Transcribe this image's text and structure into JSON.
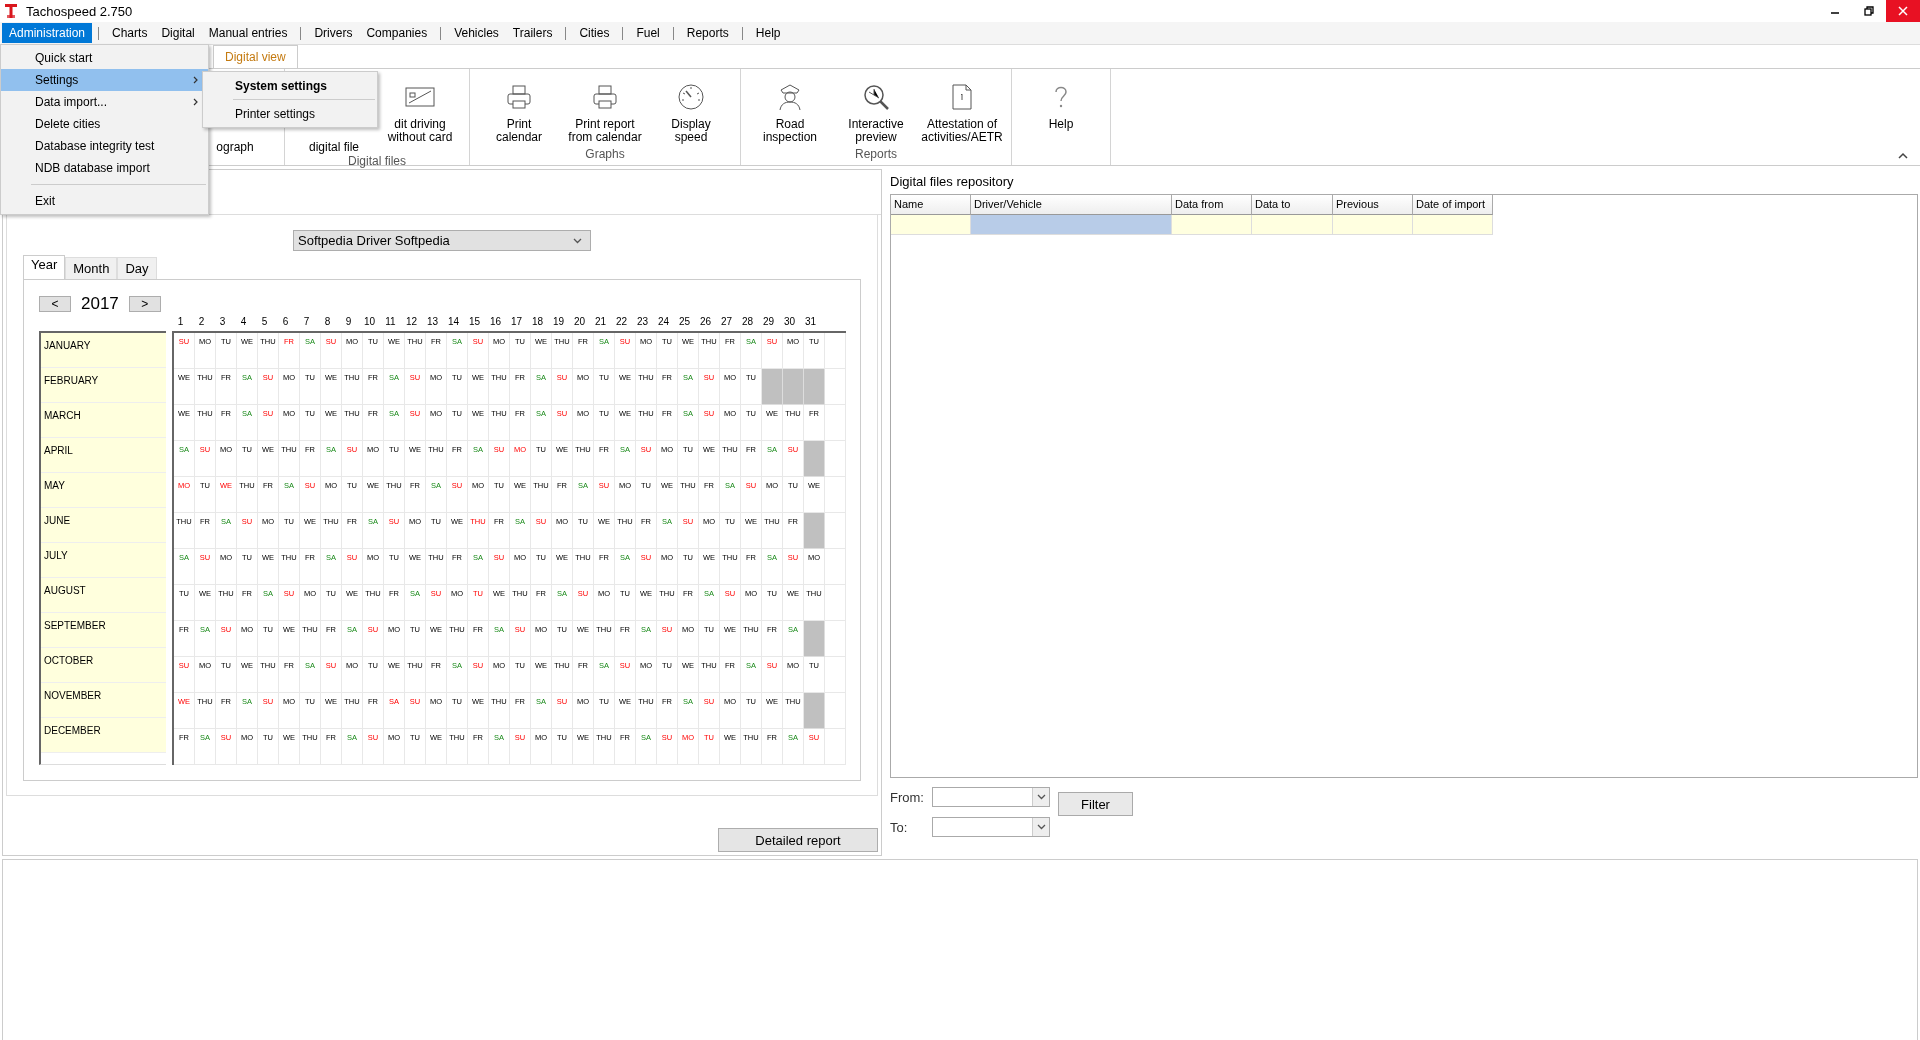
{
  "window": {
    "title": "Tachospeed 2.750"
  },
  "menu_bar": [
    {
      "label": "Administration",
      "selected": true,
      "separator_before": false
    },
    {
      "label": "Charts",
      "selected": false,
      "separator_before": true
    },
    {
      "label": "Digital",
      "selected": false,
      "separator_before": false
    },
    {
      "label": "Manual entries",
      "selected": false,
      "separator_before": false
    },
    {
      "label": "Drivers",
      "selected": false,
      "separator_before": true
    },
    {
      "label": "Companies",
      "selected": false,
      "separator_before": false
    },
    {
      "label": "Vehicles",
      "selected": false,
      "separator_before": true
    },
    {
      "label": "Trailers",
      "selected": false,
      "separator_before": false
    },
    {
      "label": "Cities",
      "selected": false,
      "separator_before": true
    },
    {
      "label": "Fuel",
      "selected": false,
      "separator_before": true
    },
    {
      "label": "Reports",
      "selected": false,
      "separator_before": true
    },
    {
      "label": "Help",
      "selected": false,
      "separator_before": true
    }
  ],
  "admin_menu": [
    {
      "kind": "item",
      "label": "Quick start",
      "selected": false,
      "submenu": false
    },
    {
      "kind": "item",
      "label": "Settings",
      "selected": true,
      "submenu": true
    },
    {
      "kind": "item",
      "label": "Data import...",
      "selected": false,
      "submenu": true
    },
    {
      "kind": "item",
      "label": "Delete cities",
      "selected": false,
      "submenu": false
    },
    {
      "kind": "item",
      "label": "Database integrity test",
      "selected": false,
      "submenu": false
    },
    {
      "kind": "item",
      "label": "NDB database import",
      "selected": false,
      "submenu": false
    },
    {
      "kind": "separator"
    },
    {
      "kind": "item",
      "label": "Exit",
      "selected": false,
      "submenu": false
    }
  ],
  "settings_submenu": [
    {
      "kind": "item",
      "label": "System settings",
      "bold": true
    },
    {
      "kind": "separator"
    },
    {
      "kind": "item",
      "label": "Printer settings",
      "bold": false
    }
  ],
  "ribbon": {
    "tabs": [
      {
        "label": "Digital view",
        "selected": true
      }
    ],
    "groups": [
      {
        "items": [
          {
            "kind": "covered",
            "lines": [
              "ograph"
            ]
          }
        ]
      },
      {
        "label": "Digital files",
        "items": [
          {
            "kind": "covered",
            "lines": [
              "digital file"
            ]
          },
          {
            "kind": "button",
            "lines": [
              "dit driving",
              "without card"
            ]
          }
        ]
      },
      {
        "label": "Graphs",
        "items": [
          {
            "kind": "button",
            "lines": [
              "Print",
              "calendar"
            ]
          },
          {
            "kind": "button",
            "lines": [
              "Print report",
              "from calendar"
            ]
          },
          {
            "kind": "button",
            "lines": [
              "Display",
              "speed"
            ]
          }
        ]
      },
      {
        "label": "Reports",
        "items": [
          {
            "kind": "button",
            "lines": [
              "Road",
              "inspection"
            ]
          },
          {
            "kind": "button",
            "lines": [
              "Interactive",
              "preview"
            ]
          },
          {
            "kind": "button",
            "lines": [
              "Attestation of",
              "activities/AETR"
            ]
          }
        ]
      },
      {
        "items": [
          {
            "kind": "button",
            "lines": [
              "Help"
            ]
          }
        ]
      }
    ]
  },
  "driver_select": {
    "value": "Softpedia Driver Softpedia"
  },
  "view_tabs": [
    {
      "label": "Year",
      "selected": true
    },
    {
      "label": "Month",
      "selected": false
    },
    {
      "label": "Day",
      "selected": false
    }
  ],
  "year_nav": {
    "prev": "<",
    "year": "2017",
    "next": ">"
  },
  "calendar": {
    "day_numbers": [
      "1",
      "2",
      "3",
      "4",
      "5",
      "6",
      "7",
      "8",
      "9",
      "10",
      "11",
      "12",
      "13",
      "14",
      "15",
      "16",
      "17",
      "18",
      "19",
      "20",
      "21",
      "22",
      "23",
      "24",
      "25",
      "26",
      "27",
      "28",
      "29",
      "30",
      "31"
    ],
    "months": [
      {
        "name": "JANUARY",
        "days": [
          {
            "day": "SU",
            "kind": "off"
          },
          {
            "day": "MO",
            "kind": "work"
          },
          {
            "day": "TU",
            "kind": "work"
          },
          {
            "day": "WE",
            "kind": "work"
          },
          {
            "day": "THU",
            "kind": "work"
          },
          {
            "day": "FR",
            "kind": "off"
          },
          {
            "day": "SA",
            "kind": "sat"
          },
          {
            "day": "SU",
            "kind": "off"
          },
          {
            "day": "MO",
            "kind": "work"
          },
          {
            "day": "TU",
            "kind": "work"
          },
          {
            "day": "WE",
            "kind": "work"
          },
          {
            "day": "THU",
            "kind": "work"
          },
          {
            "day": "FR",
            "kind": "work"
          },
          {
            "day": "SA",
            "kind": "sat"
          },
          {
            "day": "SU",
            "kind": "off"
          },
          {
            "day": "MO",
            "kind": "work"
          },
          {
            "day": "TU",
            "kind": "work"
          },
          {
            "day": "WE",
            "kind": "work"
          },
          {
            "day": "THU",
            "kind": "work"
          },
          {
            "day": "FR",
            "kind": "work"
          },
          {
            "day": "SA",
            "kind": "sat"
          },
          {
            "day": "SU",
            "kind": "off"
          },
          {
            "day": "MO",
            "kind": "work"
          },
          {
            "day": "TU",
            "kind": "work"
          },
          {
            "day": "WE",
            "kind": "work"
          },
          {
            "day": "THU",
            "kind": "work"
          },
          {
            "day": "FR",
            "kind": "work"
          },
          {
            "day": "SA",
            "kind": "sat"
          },
          {
            "day": "SU",
            "kind": "off"
          },
          {
            "day": "MO",
            "kind": "work"
          },
          {
            "day": "TU",
            "kind": "work"
          }
        ]
      },
      {
        "name": "FEBRUARY",
        "days": [
          {
            "day": "WE",
            "kind": "work"
          },
          {
            "day": "THU",
            "kind": "work"
          },
          {
            "day": "FR",
            "kind": "work"
          },
          {
            "day": "SA",
            "kind": "sat"
          },
          {
            "day": "SU",
            "kind": "off"
          },
          {
            "day": "MO",
            "kind": "work"
          },
          {
            "day": "TU",
            "kind": "work"
          },
          {
            "day": "WE",
            "kind": "work"
          },
          {
            "day": "THU",
            "kind": "work"
          },
          {
            "day": "FR",
            "kind": "work"
          },
          {
            "day": "SA",
            "kind": "sat"
          },
          {
            "day": "SU",
            "kind": "off"
          },
          {
            "day": "MO",
            "kind": "work"
          },
          {
            "day": "TU",
            "kind": "work"
          },
          {
            "day": "WE",
            "kind": "work"
          },
          {
            "day": "THU",
            "kind": "work"
          },
          {
            "day": "FR",
            "kind": "work"
          },
          {
            "day": "SA",
            "kind": "sat"
          },
          {
            "day": "SU",
            "kind": "off"
          },
          {
            "day": "MO",
            "kind": "work"
          },
          {
            "day": "TU",
            "kind": "work"
          },
          {
            "day": "WE",
            "kind": "work"
          },
          {
            "day": "THU",
            "kind": "work"
          },
          {
            "day": "FR",
            "kind": "work"
          },
          {
            "day": "SA",
            "kind": "sat"
          },
          {
            "day": "SU",
            "kind": "off"
          },
          {
            "day": "MO",
            "kind": "work"
          },
          {
            "day": "TU",
            "kind": "work"
          },
          {
            "kind": "none"
          },
          {
            "kind": "none"
          },
          {
            "kind": "none"
          }
        ]
      },
      {
        "name": "MARCH",
        "days": [
          {
            "day": "WE",
            "kind": "work"
          },
          {
            "day": "THU",
            "kind": "work"
          },
          {
            "day": "FR",
            "kind": "work"
          },
          {
            "day": "SA",
            "kind": "sat"
          },
          {
            "day": "SU",
            "kind": "off"
          },
          {
            "day": "MO",
            "kind": "work"
          },
          {
            "day": "TU",
            "kind": "work"
          },
          {
            "day": "WE",
            "kind": "work"
          },
          {
            "day": "THU",
            "kind": "work"
          },
          {
            "day": "FR",
            "kind": "work"
          },
          {
            "day": "SA",
            "kind": "sat"
          },
          {
            "day": "SU",
            "kind": "off"
          },
          {
            "day": "MO",
            "kind": "work"
          },
          {
            "day": "TU",
            "kind": "work"
          },
          {
            "day": "WE",
            "kind": "work"
          },
          {
            "day": "THU",
            "kind": "work"
          },
          {
            "day": "FR",
            "kind": "work"
          },
          {
            "day": "SA",
            "kind": "sat"
          },
          {
            "day": "SU",
            "kind": "off"
          },
          {
            "day": "MO",
            "kind": "work"
          },
          {
            "day": "TU",
            "kind": "work"
          },
          {
            "day": "WE",
            "kind": "work"
          },
          {
            "day": "THU",
            "kind": "work"
          },
          {
            "day": "FR",
            "kind": "work"
          },
          {
            "day": "SA",
            "kind": "sat"
          },
          {
            "day": "SU",
            "kind": "off"
          },
          {
            "day": "MO",
            "kind": "work"
          },
          {
            "day": "TU",
            "kind": "work"
          },
          {
            "day": "WE",
            "kind": "work"
          },
          {
            "day": "THU",
            "kind": "work"
          },
          {
            "day": "FR",
            "kind": "work"
          }
        ]
      },
      {
        "name": "APRIL",
        "days": [
          {
            "day": "SA",
            "kind": "sat"
          },
          {
            "day": "SU",
            "kind": "off"
          },
          {
            "day": "MO",
            "kind": "work"
          },
          {
            "day": "TU",
            "kind": "work"
          },
          {
            "day": "WE",
            "kind": "work"
          },
          {
            "day": "THU",
            "kind": "work"
          },
          {
            "day": "FR",
            "kind": "work"
          },
          {
            "day": "SA",
            "kind": "sat"
          },
          {
            "day": "SU",
            "kind": "off"
          },
          {
            "day": "MO",
            "kind": "work"
          },
          {
            "day": "TU",
            "kind": "work"
          },
          {
            "day": "WE",
            "kind": "work"
          },
          {
            "day": "THU",
            "kind": "work"
          },
          {
            "day": "FR",
            "kind": "work"
          },
          {
            "day": "SA",
            "kind": "sat"
          },
          {
            "day": "SU",
            "kind": "off"
          },
          {
            "day": "MO",
            "kind": "off"
          },
          {
            "day": "TU",
            "kind": "work"
          },
          {
            "day": "WE",
            "kind": "work"
          },
          {
            "day": "THU",
            "kind": "work"
          },
          {
            "day": "FR",
            "kind": "work"
          },
          {
            "day": "SA",
            "kind": "sat"
          },
          {
            "day": "SU",
            "kind": "off"
          },
          {
            "day": "MO",
            "kind": "work"
          },
          {
            "day": "TU",
            "kind": "work"
          },
          {
            "day": "WE",
            "kind": "work"
          },
          {
            "day": "THU",
            "kind": "work"
          },
          {
            "day": "FR",
            "kind": "work"
          },
          {
            "day": "SA",
            "kind": "sat"
          },
          {
            "day": "SU",
            "kind": "off"
          },
          {
            "kind": "none"
          }
        ]
      },
      {
        "name": "MAY",
        "days": [
          {
            "day": "MO",
            "kind": "off"
          },
          {
            "day": "TU",
            "kind": "work"
          },
          {
            "day": "WE",
            "kind": "off"
          },
          {
            "day": "THU",
            "kind": "work"
          },
          {
            "day": "FR",
            "kind": "work"
          },
          {
            "day": "SA",
            "kind": "sat"
          },
          {
            "day": "SU",
            "kind": "off"
          },
          {
            "day": "MO",
            "kind": "work"
          },
          {
            "day": "TU",
            "kind": "work"
          },
          {
            "day": "WE",
            "kind": "work"
          },
          {
            "day": "THU",
            "kind": "work"
          },
          {
            "day": "FR",
            "kind": "work"
          },
          {
            "day": "SA",
            "kind": "sat"
          },
          {
            "day": "SU",
            "kind": "off"
          },
          {
            "day": "MO",
            "kind": "work"
          },
          {
            "day": "TU",
            "kind": "work"
          },
          {
            "day": "WE",
            "kind": "work"
          },
          {
            "day": "THU",
            "kind": "work"
          },
          {
            "day": "FR",
            "kind": "work"
          },
          {
            "day": "SA",
            "kind": "sat"
          },
          {
            "day": "SU",
            "kind": "off"
          },
          {
            "day": "MO",
            "kind": "work"
          },
          {
            "day": "TU",
            "kind": "work"
          },
          {
            "day": "WE",
            "kind": "work"
          },
          {
            "day": "THU",
            "kind": "work"
          },
          {
            "day": "FR",
            "kind": "work"
          },
          {
            "day": "SA",
            "kind": "sat"
          },
          {
            "day": "SU",
            "kind": "off"
          },
          {
            "day": "MO",
            "kind": "work"
          },
          {
            "day": "TU",
            "kind": "work"
          },
          {
            "day": "WE",
            "kind": "work"
          }
        ]
      },
      {
        "name": "JUNE",
        "days": [
          {
            "day": "THU",
            "kind": "work"
          },
          {
            "day": "FR",
            "kind": "work"
          },
          {
            "day": "SA",
            "kind": "sat"
          },
          {
            "day": "SU",
            "kind": "off"
          },
          {
            "day": "MO",
            "kind": "work"
          },
          {
            "day": "TU",
            "kind": "work"
          },
          {
            "day": "WE",
            "kind": "work"
          },
          {
            "day": "THU",
            "kind": "work"
          },
          {
            "day": "FR",
            "kind": "work"
          },
          {
            "day": "SA",
            "kind": "sat"
          },
          {
            "day": "SU",
            "kind": "off"
          },
          {
            "day": "MO",
            "kind": "work"
          },
          {
            "day": "TU",
            "kind": "work"
          },
          {
            "day": "WE",
            "kind": "work"
          },
          {
            "day": "THU",
            "kind": "off"
          },
          {
            "day": "FR",
            "kind": "work"
          },
          {
            "day": "SA",
            "kind": "sat"
          },
          {
            "day": "SU",
            "kind": "off"
          },
          {
            "day": "MO",
            "kind": "work"
          },
          {
            "day": "TU",
            "kind": "work"
          },
          {
            "day": "WE",
            "kind": "work"
          },
          {
            "day": "THU",
            "kind": "work"
          },
          {
            "day": "FR",
            "kind": "work"
          },
          {
            "day": "SA",
            "kind": "sat"
          },
          {
            "day": "SU",
            "kind": "off"
          },
          {
            "day": "MO",
            "kind": "work"
          },
          {
            "day": "TU",
            "kind": "work"
          },
          {
            "day": "WE",
            "kind": "work"
          },
          {
            "day": "THU",
            "kind": "work"
          },
          {
            "day": "FR",
            "kind": "work"
          },
          {
            "kind": "none"
          }
        ]
      },
      {
        "name": "JULY",
        "days": [
          {
            "day": "SA",
            "kind": "sat"
          },
          {
            "day": "SU",
            "kind": "off"
          },
          {
            "day": "MO",
            "kind": "work"
          },
          {
            "day": "TU",
            "kind": "work"
          },
          {
            "day": "WE",
            "kind": "work"
          },
          {
            "day": "THU",
            "kind": "work"
          },
          {
            "day": "FR",
            "kind": "work"
          },
          {
            "day": "SA",
            "kind": "sat"
          },
          {
            "day": "SU",
            "kind": "off"
          },
          {
            "day": "MO",
            "kind": "work"
          },
          {
            "day": "TU",
            "kind": "work"
          },
          {
            "day": "WE",
            "kind": "work"
          },
          {
            "day": "THU",
            "kind": "work"
          },
          {
            "day": "FR",
            "kind": "work"
          },
          {
            "day": "SA",
            "kind": "sat"
          },
          {
            "day": "SU",
            "kind": "off"
          },
          {
            "day": "MO",
            "kind": "work"
          },
          {
            "day": "TU",
            "kind": "work"
          },
          {
            "day": "WE",
            "kind": "work"
          },
          {
            "day": "THU",
            "kind": "work"
          },
          {
            "day": "FR",
            "kind": "work"
          },
          {
            "day": "SA",
            "kind": "sat"
          },
          {
            "day": "SU",
            "kind": "off"
          },
          {
            "day": "MO",
            "kind": "work"
          },
          {
            "day": "TU",
            "kind": "work"
          },
          {
            "day": "WE",
            "kind": "work"
          },
          {
            "day": "THU",
            "kind": "work"
          },
          {
            "day": "FR",
            "kind": "work"
          },
          {
            "day": "SA",
            "kind": "sat"
          },
          {
            "day": "SU",
            "kind": "off"
          },
          {
            "day": "MO",
            "kind": "work"
          }
        ]
      },
      {
        "name": "AUGUST",
        "days": [
          {
            "day": "TU",
            "kind": "work"
          },
          {
            "day": "WE",
            "kind": "work"
          },
          {
            "day": "THU",
            "kind": "work"
          },
          {
            "day": "FR",
            "kind": "work"
          },
          {
            "day": "SA",
            "kind": "sat"
          },
          {
            "day": "SU",
            "kind": "off"
          },
          {
            "day": "MO",
            "kind": "work"
          },
          {
            "day": "TU",
            "kind": "work"
          },
          {
            "day": "WE",
            "kind": "work"
          },
          {
            "day": "THU",
            "kind": "work"
          },
          {
            "day": "FR",
            "kind": "work"
          },
          {
            "day": "SA",
            "kind": "sat"
          },
          {
            "day": "SU",
            "kind": "off"
          },
          {
            "day": "MO",
            "kind": "work"
          },
          {
            "day": "TU",
            "kind": "off"
          },
          {
            "day": "WE",
            "kind": "work"
          },
          {
            "day": "THU",
            "kind": "work"
          },
          {
            "day": "FR",
            "kind": "work"
          },
          {
            "day": "SA",
            "kind": "sat"
          },
          {
            "day": "SU",
            "kind": "off"
          },
          {
            "day": "MO",
            "kind": "work"
          },
          {
            "day": "TU",
            "kind": "work"
          },
          {
            "day": "WE",
            "kind": "work"
          },
          {
            "day": "THU",
            "kind": "work"
          },
          {
            "day": "FR",
            "kind": "work"
          },
          {
            "day": "SA",
            "kind": "sat"
          },
          {
            "day": "SU",
            "kind": "off"
          },
          {
            "day": "MO",
            "kind": "work"
          },
          {
            "day": "TU",
            "kind": "work"
          },
          {
            "day": "WE",
            "kind": "work"
          },
          {
            "day": "THU",
            "kind": "work"
          }
        ]
      },
      {
        "name": "SEPTEMBER",
        "days": [
          {
            "day": "FR",
            "kind": "work"
          },
          {
            "day": "SA",
            "kind": "sat"
          },
          {
            "day": "SU",
            "kind": "off"
          },
          {
            "day": "MO",
            "kind": "work"
          },
          {
            "day": "TU",
            "kind": "work"
          },
          {
            "day": "WE",
            "kind": "work"
          },
          {
            "day": "THU",
            "kind": "work"
          },
          {
            "day": "FR",
            "kind": "work"
          },
          {
            "day": "SA",
            "kind": "sat"
          },
          {
            "day": "SU",
            "kind": "off"
          },
          {
            "day": "MO",
            "kind": "work"
          },
          {
            "day": "TU",
            "kind": "work"
          },
          {
            "day": "WE",
            "kind": "work"
          },
          {
            "day": "THU",
            "kind": "work"
          },
          {
            "day": "FR",
            "kind": "work"
          },
          {
            "day": "SA",
            "kind": "sat"
          },
          {
            "day": "SU",
            "kind": "off"
          },
          {
            "day": "MO",
            "kind": "work"
          },
          {
            "day": "TU",
            "kind": "work"
          },
          {
            "day": "WE",
            "kind": "work"
          },
          {
            "day": "THU",
            "kind": "work"
          },
          {
            "day": "FR",
            "kind": "work"
          },
          {
            "day": "SA",
            "kind": "sat"
          },
          {
            "day": "SU",
            "kind": "off"
          },
          {
            "day": "MO",
            "kind": "work"
          },
          {
            "day": "TU",
            "kind": "work"
          },
          {
            "day": "WE",
            "kind": "work"
          },
          {
            "day": "THU",
            "kind": "work"
          },
          {
            "day": "FR",
            "kind": "work"
          },
          {
            "day": "SA",
            "kind": "sat"
          },
          {
            "kind": "none"
          }
        ]
      },
      {
        "name": "OCTOBER",
        "days": [
          {
            "day": "SU",
            "kind": "off"
          },
          {
            "day": "MO",
            "kind": "work"
          },
          {
            "day": "TU",
            "kind": "work"
          },
          {
            "day": "WE",
            "kind": "work"
          },
          {
            "day": "THU",
            "kind": "work"
          },
          {
            "day": "FR",
            "kind": "work"
          },
          {
            "day": "SA",
            "kind": "sat"
          },
          {
            "day": "SU",
            "kind": "off"
          },
          {
            "day": "MO",
            "kind": "work"
          },
          {
            "day": "TU",
            "kind": "work"
          },
          {
            "day": "WE",
            "kind": "work"
          },
          {
            "day": "THU",
            "kind": "work"
          },
          {
            "day": "FR",
            "kind": "work"
          },
          {
            "day": "SA",
            "kind": "sat"
          },
          {
            "day": "SU",
            "kind": "off"
          },
          {
            "day": "MO",
            "kind": "work"
          },
          {
            "day": "TU",
            "kind": "work"
          },
          {
            "day": "WE",
            "kind": "work"
          },
          {
            "day": "THU",
            "kind": "work"
          },
          {
            "day": "FR",
            "kind": "work"
          },
          {
            "day": "SA",
            "kind": "sat"
          },
          {
            "day": "SU",
            "kind": "off"
          },
          {
            "day": "MO",
            "kind": "work"
          },
          {
            "day": "TU",
            "kind": "work"
          },
          {
            "day": "WE",
            "kind": "work"
          },
          {
            "day": "THU",
            "kind": "work"
          },
          {
            "day": "FR",
            "kind": "work"
          },
          {
            "day": "SA",
            "kind": "sat"
          },
          {
            "day": "SU",
            "kind": "off"
          },
          {
            "day": "MO",
            "kind": "work"
          },
          {
            "day": "TU",
            "kind": "work"
          }
        ]
      },
      {
        "name": "NOVEMBER",
        "days": [
          {
            "day": "WE",
            "kind": "off"
          },
          {
            "day": "THU",
            "kind": "work"
          },
          {
            "day": "FR",
            "kind": "work"
          },
          {
            "day": "SA",
            "kind": "sat"
          },
          {
            "day": "SU",
            "kind": "off"
          },
          {
            "day": "MO",
            "kind": "work"
          },
          {
            "day": "TU",
            "kind": "work"
          },
          {
            "day": "WE",
            "kind": "work"
          },
          {
            "day": "THU",
            "kind": "work"
          },
          {
            "day": "FR",
            "kind": "work"
          },
          {
            "day": "SA",
            "kind": "off"
          },
          {
            "day": "SU",
            "kind": "off"
          },
          {
            "day": "MO",
            "kind": "work"
          },
          {
            "day": "TU",
            "kind": "work"
          },
          {
            "day": "WE",
            "kind": "work"
          },
          {
            "day": "THU",
            "kind": "work"
          },
          {
            "day": "FR",
            "kind": "work"
          },
          {
            "day": "SA",
            "kind": "sat"
          },
          {
            "day": "SU",
            "kind": "off"
          },
          {
            "day": "MO",
            "kind": "work"
          },
          {
            "day": "TU",
            "kind": "work"
          },
          {
            "day": "WE",
            "kind": "work"
          },
          {
            "day": "THU",
            "kind": "work"
          },
          {
            "day": "FR",
            "kind": "work"
          },
          {
            "day": "SA",
            "kind": "sat"
          },
          {
            "day": "SU",
            "kind": "off"
          },
          {
            "day": "MO",
            "kind": "work"
          },
          {
            "day": "TU",
            "kind": "work"
          },
          {
            "day": "WE",
            "kind": "work"
          },
          {
            "day": "THU",
            "kind": "work"
          },
          {
            "kind": "none"
          }
        ]
      },
      {
        "name": "DECEMBER",
        "days": [
          {
            "day": "FR",
            "kind": "work"
          },
          {
            "day": "SA",
            "kind": "sat"
          },
          {
            "day": "SU",
            "kind": "off"
          },
          {
            "day": "MO",
            "kind": "work"
          },
          {
            "day": "TU",
            "kind": "work"
          },
          {
            "day": "WE",
            "kind": "work"
          },
          {
            "day": "THU",
            "kind": "work"
          },
          {
            "day": "FR",
            "kind": "work"
          },
          {
            "day": "SA",
            "kind": "sat"
          },
          {
            "day": "SU",
            "kind": "off"
          },
          {
            "day": "MO",
            "kind": "work"
          },
          {
            "day": "TU",
            "kind": "work"
          },
          {
            "day": "WE",
            "kind": "work"
          },
          {
            "day": "THU",
            "kind": "work"
          },
          {
            "day": "FR",
            "kind": "work"
          },
          {
            "day": "SA",
            "kind": "sat"
          },
          {
            "day": "SU",
            "kind": "off"
          },
          {
            "day": "MO",
            "kind": "work"
          },
          {
            "day": "TU",
            "kind": "work"
          },
          {
            "day": "WE",
            "kind": "work"
          },
          {
            "day": "THU",
            "kind": "work"
          },
          {
            "day": "FR",
            "kind": "work"
          },
          {
            "day": "SA",
            "kind": "sat"
          },
          {
            "day": "SU",
            "kind": "off"
          },
          {
            "day": "MO",
            "kind": "off"
          },
          {
            "day": "TU",
            "kind": "off"
          },
          {
            "day": "WE",
            "kind": "work"
          },
          {
            "day": "THU",
            "kind": "work"
          },
          {
            "day": "FR",
            "kind": "work"
          },
          {
            "day": "SA",
            "kind": "sat"
          },
          {
            "day": "SU",
            "kind": "off"
          }
        ]
      }
    ]
  },
  "detailed_report_button": "Detailed report",
  "repository": {
    "title": "Digital files repository",
    "columns": [
      "Name",
      "Driver/Vehicle",
      "Data from",
      "Data to",
      "Previous",
      "Date of import"
    ],
    "rows": [
      {
        "cells": [
          {
            "selected": false
          },
          {
            "selected": true
          },
          {
            "selected": false
          },
          {
            "selected": false
          },
          {
            "selected": false
          },
          {
            "selected": false
          }
        ]
      }
    ]
  },
  "filter": {
    "from_label": "From:",
    "to_label": "To:",
    "button": "Filter"
  }
}
